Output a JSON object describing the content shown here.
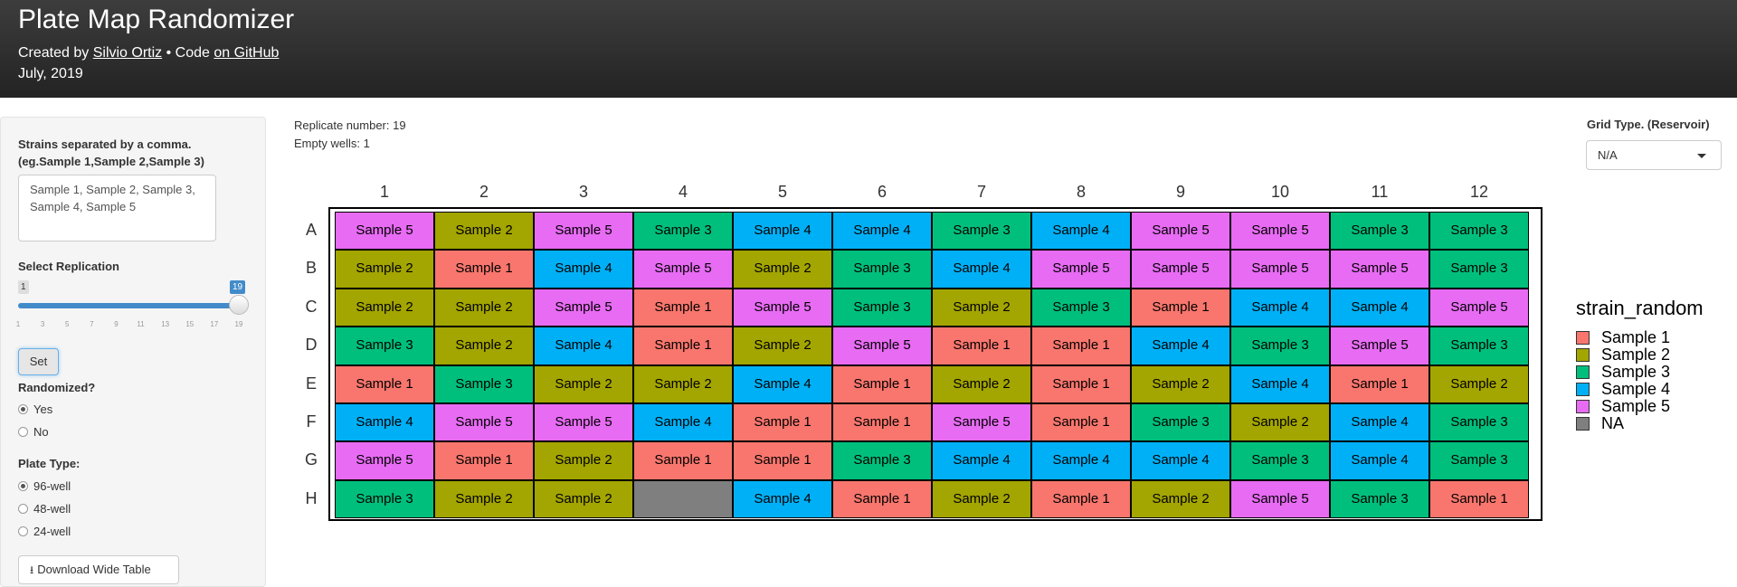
{
  "header": {
    "title": "Plate Map Randomizer",
    "created_by_prefix": "Created by ",
    "author_link": "Silvio Ortiz",
    "separator": " • Code ",
    "code_link": "on GitHub",
    "date": "July, 2019"
  },
  "sidebar": {
    "strains_label_line1": "Strains separated by a comma.",
    "strains_label_line2": "(eg.Sample 1,Sample 2,Sample 3)",
    "strains_value": "Sample 1, Sample 2, Sample 3, Sample 4, Sample 5",
    "replication_label": "Select Replication",
    "slider_min": "1",
    "slider_max": "19",
    "slider_value": 19,
    "slider_ticks": [
      "1",
      "3",
      "5",
      "7",
      "9",
      "11",
      "13",
      "15",
      "17",
      "19"
    ],
    "set_button": "Set",
    "randomized_label": "Randomized?",
    "randomized_options": [
      "Yes",
      "No"
    ],
    "randomized_selected": "Yes",
    "plate_type_label": "Plate Type:",
    "plate_type_options": [
      "96-well",
      "48-well",
      "24-well"
    ],
    "plate_type_selected": "96-well",
    "download_button": "Download Wide Table",
    "download_icon": "download-icon"
  },
  "info": {
    "replicate": "Replicate number: 19",
    "empty": "Empty wells: 1"
  },
  "grid_type": {
    "label": "Grid Type. (Reservoir)",
    "value": "N/A"
  },
  "plate": {
    "columns": [
      "1",
      "2",
      "3",
      "4",
      "5",
      "6",
      "7",
      "8",
      "9",
      "10",
      "11",
      "12"
    ],
    "rows": [
      "A",
      "B",
      "C",
      "D",
      "E",
      "F",
      "G",
      "H"
    ],
    "wells": [
      [
        "Sample 5",
        "Sample 2",
        "Sample 5",
        "Sample 3",
        "Sample 4",
        "Sample 4",
        "Sample 3",
        "Sample 4",
        "Sample 5",
        "Sample 5",
        "Sample 3",
        "Sample 3"
      ],
      [
        "Sample 2",
        "Sample 1",
        "Sample 4",
        "Sample 5",
        "Sample 2",
        "Sample 3",
        "Sample 4",
        "Sample 5",
        "Sample 5",
        "Sample 5",
        "Sample 5",
        "Sample 3"
      ],
      [
        "Sample 2",
        "Sample 2",
        "Sample 5",
        "Sample 1",
        "Sample 5",
        "Sample 3",
        "Sample 2",
        "Sample 3",
        "Sample 1",
        "Sample 4",
        "Sample 4",
        "Sample 5"
      ],
      [
        "Sample 3",
        "Sample 2",
        "Sample 4",
        "Sample 1",
        "Sample 2",
        "Sample 5",
        "Sample 1",
        "Sample 1",
        "Sample 4",
        "Sample 3",
        "Sample 5",
        "Sample 3"
      ],
      [
        "Sample 1",
        "Sample 3",
        "Sample 2",
        "Sample 2",
        "Sample 4",
        "Sample 1",
        "Sample 2",
        "Sample 1",
        "Sample 2",
        "Sample 4",
        "Sample 1",
        "Sample 2"
      ],
      [
        "Sample 4",
        "Sample 5",
        "Sample 5",
        "Sample 4",
        "Sample 1",
        "Sample 1",
        "Sample 5",
        "Sample 1",
        "Sample 3",
        "Sample 2",
        "Sample 4",
        "Sample 3"
      ],
      [
        "Sample 5",
        "Sample 1",
        "Sample 2",
        "Sample 1",
        "Sample 1",
        "Sample 3",
        "Sample 4",
        "Sample 4",
        "Sample 4",
        "Sample 3",
        "Sample 4",
        "Sample 3"
      ],
      [
        "Sample 3",
        "Sample 2",
        "Sample 2",
        "NA",
        "Sample 4",
        "Sample 1",
        "Sample 2",
        "Sample 1",
        "Sample 2",
        "Sample 5",
        "Sample 3",
        "Sample 1"
      ]
    ]
  },
  "legend": {
    "title": "strain_random",
    "items": [
      {
        "label": "Sample 1",
        "color": "#F8766D"
      },
      {
        "label": "Sample 2",
        "color": "#A3A500"
      },
      {
        "label": "Sample 3",
        "color": "#00BF7D"
      },
      {
        "label": "Sample 4",
        "color": "#00B0F6"
      },
      {
        "label": "Sample 5",
        "color": "#E76BF3"
      },
      {
        "label": "NA",
        "color": "#7F7F7F"
      }
    ]
  }
}
